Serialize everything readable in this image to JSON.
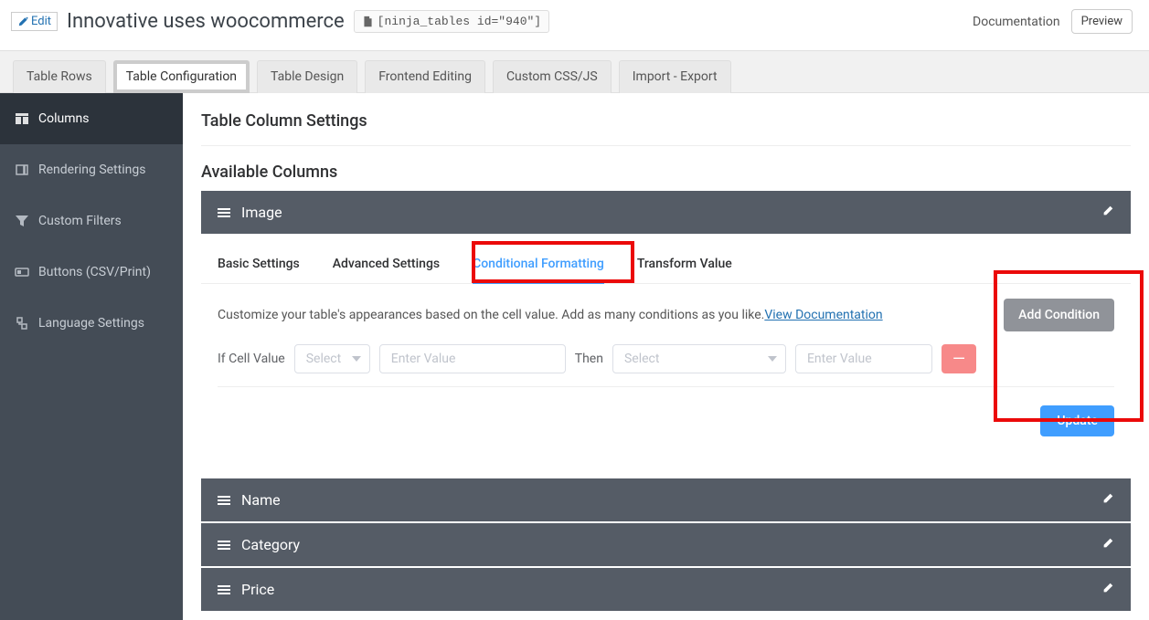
{
  "header": {
    "edit_label": "Edit",
    "title": "Innovative uses woocommerce",
    "shortcode": "[ninja_tables id=\"940\"]",
    "documentation_label": "Documentation",
    "preview_label": "Preview"
  },
  "tabs": {
    "items": [
      {
        "label": "Table Rows"
      },
      {
        "label": "Table Configuration"
      },
      {
        "label": "Table Design"
      },
      {
        "label": "Frontend Editing"
      },
      {
        "label": "Custom CSS/JS"
      },
      {
        "label": "Import - Export"
      }
    ]
  },
  "sidebar": {
    "items": [
      {
        "label": "Columns"
      },
      {
        "label": "Rendering Settings"
      },
      {
        "label": "Custom Filters"
      },
      {
        "label": "Buttons (CSV/Print)"
      },
      {
        "label": "Language Settings"
      }
    ]
  },
  "main": {
    "section_title": "Table Column Settings",
    "available_title": "Available Columns",
    "column_name": "Image",
    "inner_tabs": [
      {
        "label": "Basic Settings"
      },
      {
        "label": "Advanced Settings"
      },
      {
        "label": "Conditional Formatting"
      },
      {
        "label": "Transform Value"
      }
    ],
    "description_text": "Customize your table's appearances based on the cell value. Add as many conditions as you like. ",
    "view_doc_label": "View Documentation",
    "add_condition_label": "Add Condition",
    "if_label": "If Cell Value",
    "select_placeholder": "Select",
    "enter_value_placeholder": "Enter Value",
    "then_label": "Then",
    "remove_symbol": "—",
    "update_label": "Update",
    "other_columns": [
      {
        "label": "Name"
      },
      {
        "label": "Category"
      },
      {
        "label": "Price"
      }
    ]
  }
}
